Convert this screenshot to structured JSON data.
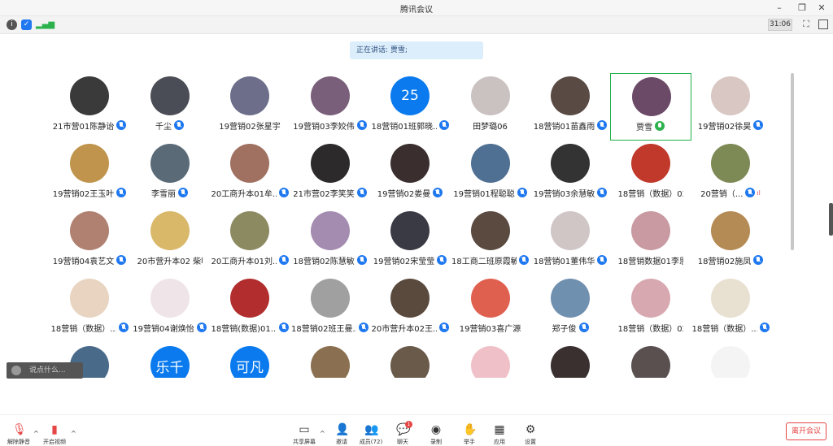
{
  "window": {
    "title": "腾讯会议"
  },
  "toolbar": {
    "timer": "31:06"
  },
  "speaking": {
    "label": "正在讲话: 贾雪;"
  },
  "participants": [
    {
      "name": "21市营01陈静诒",
      "mic": "on",
      "avatar_bg": "#3a3a3a"
    },
    {
      "name": "千尘",
      "mic": "on",
      "avatar_bg": "#4a4d55"
    },
    {
      "name": "19营销02张星宇",
      "mic": "none",
      "avatar_bg": "#6d6e8a"
    },
    {
      "name": "19营销03李姣伟",
      "mic": "on",
      "avatar_bg": "#7a5f7a"
    },
    {
      "name": "18营销01班郭晓...",
      "mic": "on",
      "avatar_text": "25",
      "avatar_bg": "#0a7aee"
    },
    {
      "name": "田梦璐06",
      "mic": "none",
      "avatar_bg": "#c9c2c0"
    },
    {
      "name": "18营销01苗鑫雨",
      "mic": "on",
      "avatar_bg": "#5a4a44"
    },
    {
      "name": "贾雪",
      "mic": "green",
      "avatar_bg": "#6a4a66"
    },
    {
      "name": "19营销02徐昊",
      "mic": "on",
      "avatar_bg": "#d8c7c2"
    },
    {
      "name": "19营销02王玉叶",
      "mic": "on",
      "avatar_bg": "#c0944d"
    },
    {
      "name": "李雪丽",
      "mic": "on",
      "avatar_bg": "#5a6a77"
    },
    {
      "name": "20工商升本01牟...",
      "mic": "on",
      "avatar_bg": "#a07060"
    },
    {
      "name": "21市营02李笑笑",
      "mic": "on",
      "avatar_bg": "#2c2a2a"
    },
    {
      "name": "19营销02娄曼",
      "mic": "on",
      "avatar_bg": "#3a2e2e"
    },
    {
      "name": "19营销01程聪聪",
      "mic": "on",
      "avatar_bg": "#4f7093"
    },
    {
      "name": "19营销03余慧敏",
      "mic": "on",
      "avatar_bg": "#333333"
    },
    {
      "name": "18营销（数据）02...",
      "mic": "none",
      "avatar_bg": "#c0392b"
    },
    {
      "name": "20营销（...",
      "mic": "on",
      "signal": "ıl",
      "avatar_bg": "#7e8a55"
    },
    {
      "name": "19营销04袁艺文",
      "mic": "on",
      "avatar_bg": "#b08070"
    },
    {
      "name": "20市营升本02 柴明倩",
      "mic": "none",
      "avatar_bg": "#d9b86a"
    },
    {
      "name": "20工商升本01刘...",
      "mic": "on",
      "avatar_bg": "#8c8a60"
    },
    {
      "name": "18营销02陈慧敏",
      "mic": "on",
      "avatar_bg": "#a48bb0"
    },
    {
      "name": "19营销02宋莹莹",
      "mic": "on",
      "avatar_bg": "#3a3a44"
    },
    {
      "name": "18工商二班原霞敏",
      "mic": "on",
      "avatar_bg": "#5a4a40"
    },
    {
      "name": "18营销01董伟华",
      "mic": "on",
      "avatar_bg": "#d0c6c6"
    },
    {
      "name": "18营销数据01李思媛",
      "mic": "none",
      "avatar_bg": "#c99aa2"
    },
    {
      "name": "18营销02施凤",
      "mic": "on",
      "avatar_bg": "#b58b55"
    },
    {
      "name": "18营销（数据）...",
      "mic": "on",
      "avatar_bg": "#e8d4c0"
    },
    {
      "name": "19营销04谢焕怡",
      "mic": "on",
      "avatar_bg": "#efe4e8"
    },
    {
      "name": "18营销(数据)01...",
      "mic": "on",
      "avatar_bg": "#b22d2d"
    },
    {
      "name": "18营销02班王曼...",
      "mic": "on",
      "avatar_bg": "#a0a0a0"
    },
    {
      "name": "20市营升本02王...",
      "mic": "on",
      "avatar_bg": "#5a4a3e"
    },
    {
      "name": "19营销03喜广源",
      "mic": "none",
      "avatar_bg": "#e06050"
    },
    {
      "name": "郑子俊",
      "mic": "on",
      "avatar_bg": "#7090b0"
    },
    {
      "name": "18营销（数据）02...",
      "mic": "none",
      "avatar_bg": "#d8a8b0"
    },
    {
      "name": "18营销（数据）...",
      "mic": "on",
      "avatar_bg": "#e8e0d0"
    },
    {
      "name": "",
      "mic": "none",
      "avatar_bg": "#4a6a8a"
    },
    {
      "name": "",
      "mic": "none",
      "avatar_text": "乐千",
      "avatar_bg": "#0a7aee"
    },
    {
      "name": "",
      "mic": "none",
      "avatar_text": "可凡",
      "avatar_bg": "#0a7aee"
    },
    {
      "name": "",
      "mic": "none",
      "avatar_bg": "#8a7050"
    },
    {
      "name": "",
      "mic": "none",
      "avatar_bg": "#6a5a4a"
    },
    {
      "name": "",
      "mic": "none",
      "avatar_bg": "#f0c0c8"
    },
    {
      "name": "",
      "mic": "none",
      "avatar_bg": "#3a3030"
    },
    {
      "name": "",
      "mic": "none",
      "avatar_bg": "#5a5050"
    },
    {
      "name": "",
      "mic": "none",
      "avatar_bg": "#f4f4f4"
    }
  ],
  "chat": {
    "placeholder": "说点什么..."
  },
  "bottom": {
    "unmute": "解除静音",
    "video": "开启视频",
    "share": "共享屏幕",
    "invite": "邀请",
    "members": "成员(72)",
    "chat": "聊天",
    "chat_badge": "1",
    "record": "录制",
    "raise": "举手",
    "apps": "应用",
    "settings": "设置",
    "leave": "离开会议"
  },
  "colors": {
    "accent": "#0a7aee",
    "highlight": "#23b04a",
    "danger": "#e64545"
  }
}
